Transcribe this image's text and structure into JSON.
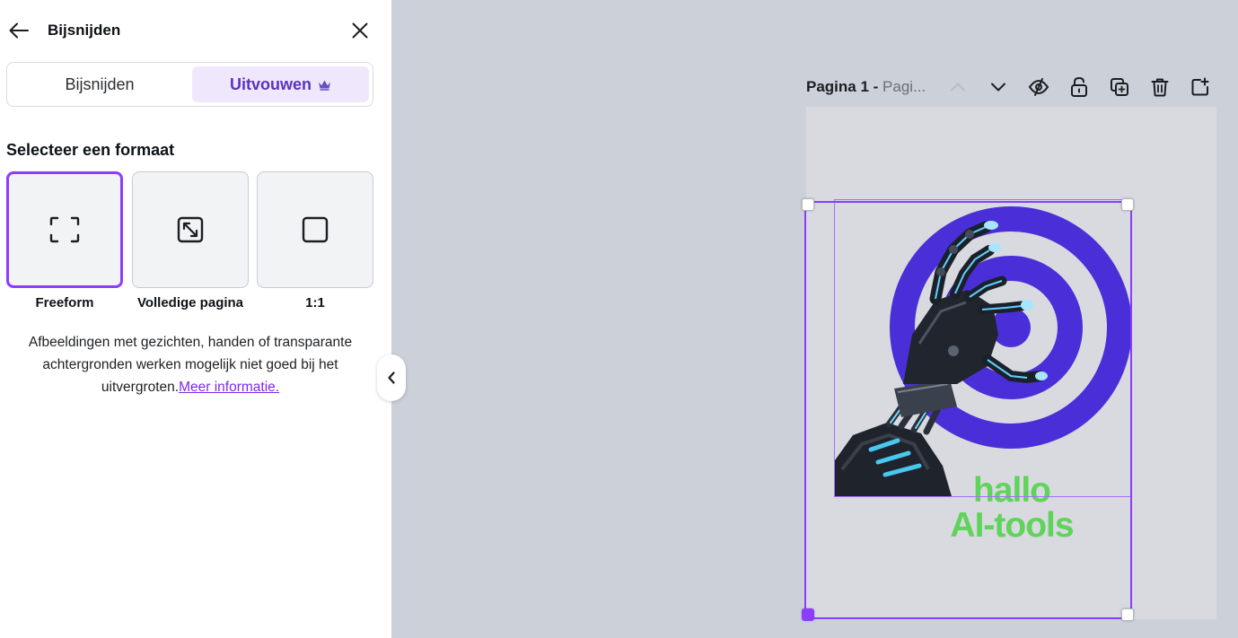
{
  "panel": {
    "title": "Bijsnijden",
    "tabs": [
      {
        "label": "Bijsnijden",
        "active": false
      },
      {
        "label": "Uitvouwen",
        "active": true,
        "icon": "crown-icon"
      }
    ],
    "section_title": "Selecteer een formaat",
    "formats": [
      {
        "label": "Freeform",
        "icon": "freeform-icon",
        "selected": true
      },
      {
        "label": "Volledige pagina",
        "icon": "expand-diagonal-icon",
        "selected": false
      },
      {
        "label": "1:1",
        "icon": "square-icon",
        "selected": false
      }
    ],
    "info_text": "Afbeeldingen met gezichten, handen of transparante achtergronden werken mogelijk niet goed bij het uitvergroten.",
    "info_link": "Meer informatie."
  },
  "toolbar": {
    "page_number": "Pagina 1 -",
    "page_name": "Pagi...",
    "icons": [
      "chevron-up-icon",
      "chevron-down-icon",
      "hide-eye-icon",
      "unlock-icon",
      "duplicate-icon",
      "trash-icon",
      "add-page-icon"
    ]
  },
  "canvas": {
    "text_line1": "hallo",
    "text_line2": "AI-tools"
  },
  "colors": {
    "accent": "#8b3dff",
    "tab_active_bg": "#efe8fd",
    "target_ring": "#4a2fd8",
    "canvas_text": "#5fd35a",
    "workspace_bg": "#ccd0d9",
    "page_bg": "#d8dae0"
  }
}
